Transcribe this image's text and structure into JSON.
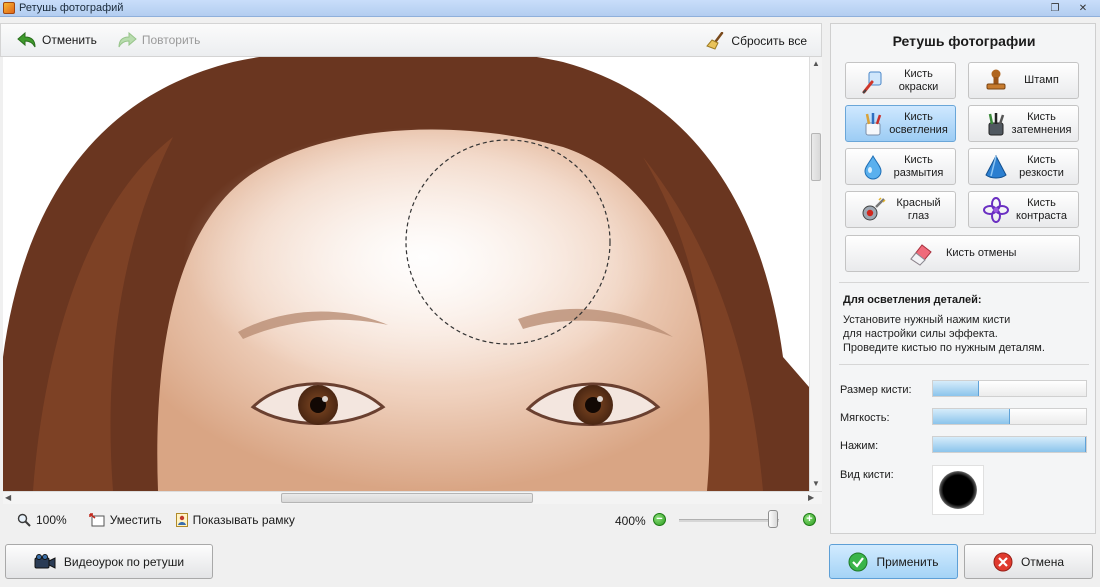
{
  "window": {
    "title": "Ретушь фотографий"
  },
  "toolbar": {
    "undo_label": "Отменить",
    "redo_label": "Повторить",
    "reset_label": "Сбросить все"
  },
  "statusbar": {
    "zoom_value": "100%",
    "fit_label": "Уместить",
    "show_frame_label": "Показывать рамку",
    "zoom_percent": "400%"
  },
  "panel": {
    "title": "Ретушь фотографии",
    "tools": [
      {
        "line1": "Кисть",
        "line2": "окраски",
        "icon": "paint-brush-icon",
        "active": false
      },
      {
        "line1": "Штамп",
        "line2": "",
        "icon": "stamp-icon",
        "active": false
      },
      {
        "line1": "Кисть",
        "line2": "осветления",
        "icon": "lighten-brush-icon",
        "active": true
      },
      {
        "line1": "Кисть",
        "line2": "затемнения",
        "icon": "darken-brush-icon",
        "active": false
      },
      {
        "line1": "Кисть",
        "line2": "размытия",
        "icon": "blur-drop-icon",
        "active": false
      },
      {
        "line1": "Кисть",
        "line2": "резкости",
        "icon": "sharpen-cone-icon",
        "active": false
      },
      {
        "line1": "Красный",
        "line2": "глаз",
        "icon": "red-eye-icon",
        "active": false
      },
      {
        "line1": "Кисть",
        "line2": "контраста",
        "icon": "contrast-flower-icon",
        "active": false
      }
    ],
    "undo_brush_label": "Кисть отмены",
    "help": {
      "title": "Для осветления деталей:",
      "lines": [
        "Установите нужный нажим кисти",
        "для настройки силы эффекта.",
        "Проведите кистью по нужным деталям."
      ]
    },
    "params": {
      "size_label": "Размер кисти:",
      "size_value": 0.3,
      "softness_label": "Мягкость:",
      "softness_value": 0.5,
      "pressure_label": "Нажим:",
      "pressure_value": 1.0,
      "brush_view_label": "Вид кисти:"
    }
  },
  "bottom": {
    "video_label": "Видеоурок по ретуши",
    "apply_label": "Применить",
    "cancel_label": "Отмена"
  },
  "colors": {
    "accent": "#9ccdf4",
    "titlebar": "#b9d1f1",
    "skin": "#e8c1a4",
    "hair": "#6a3620"
  }
}
